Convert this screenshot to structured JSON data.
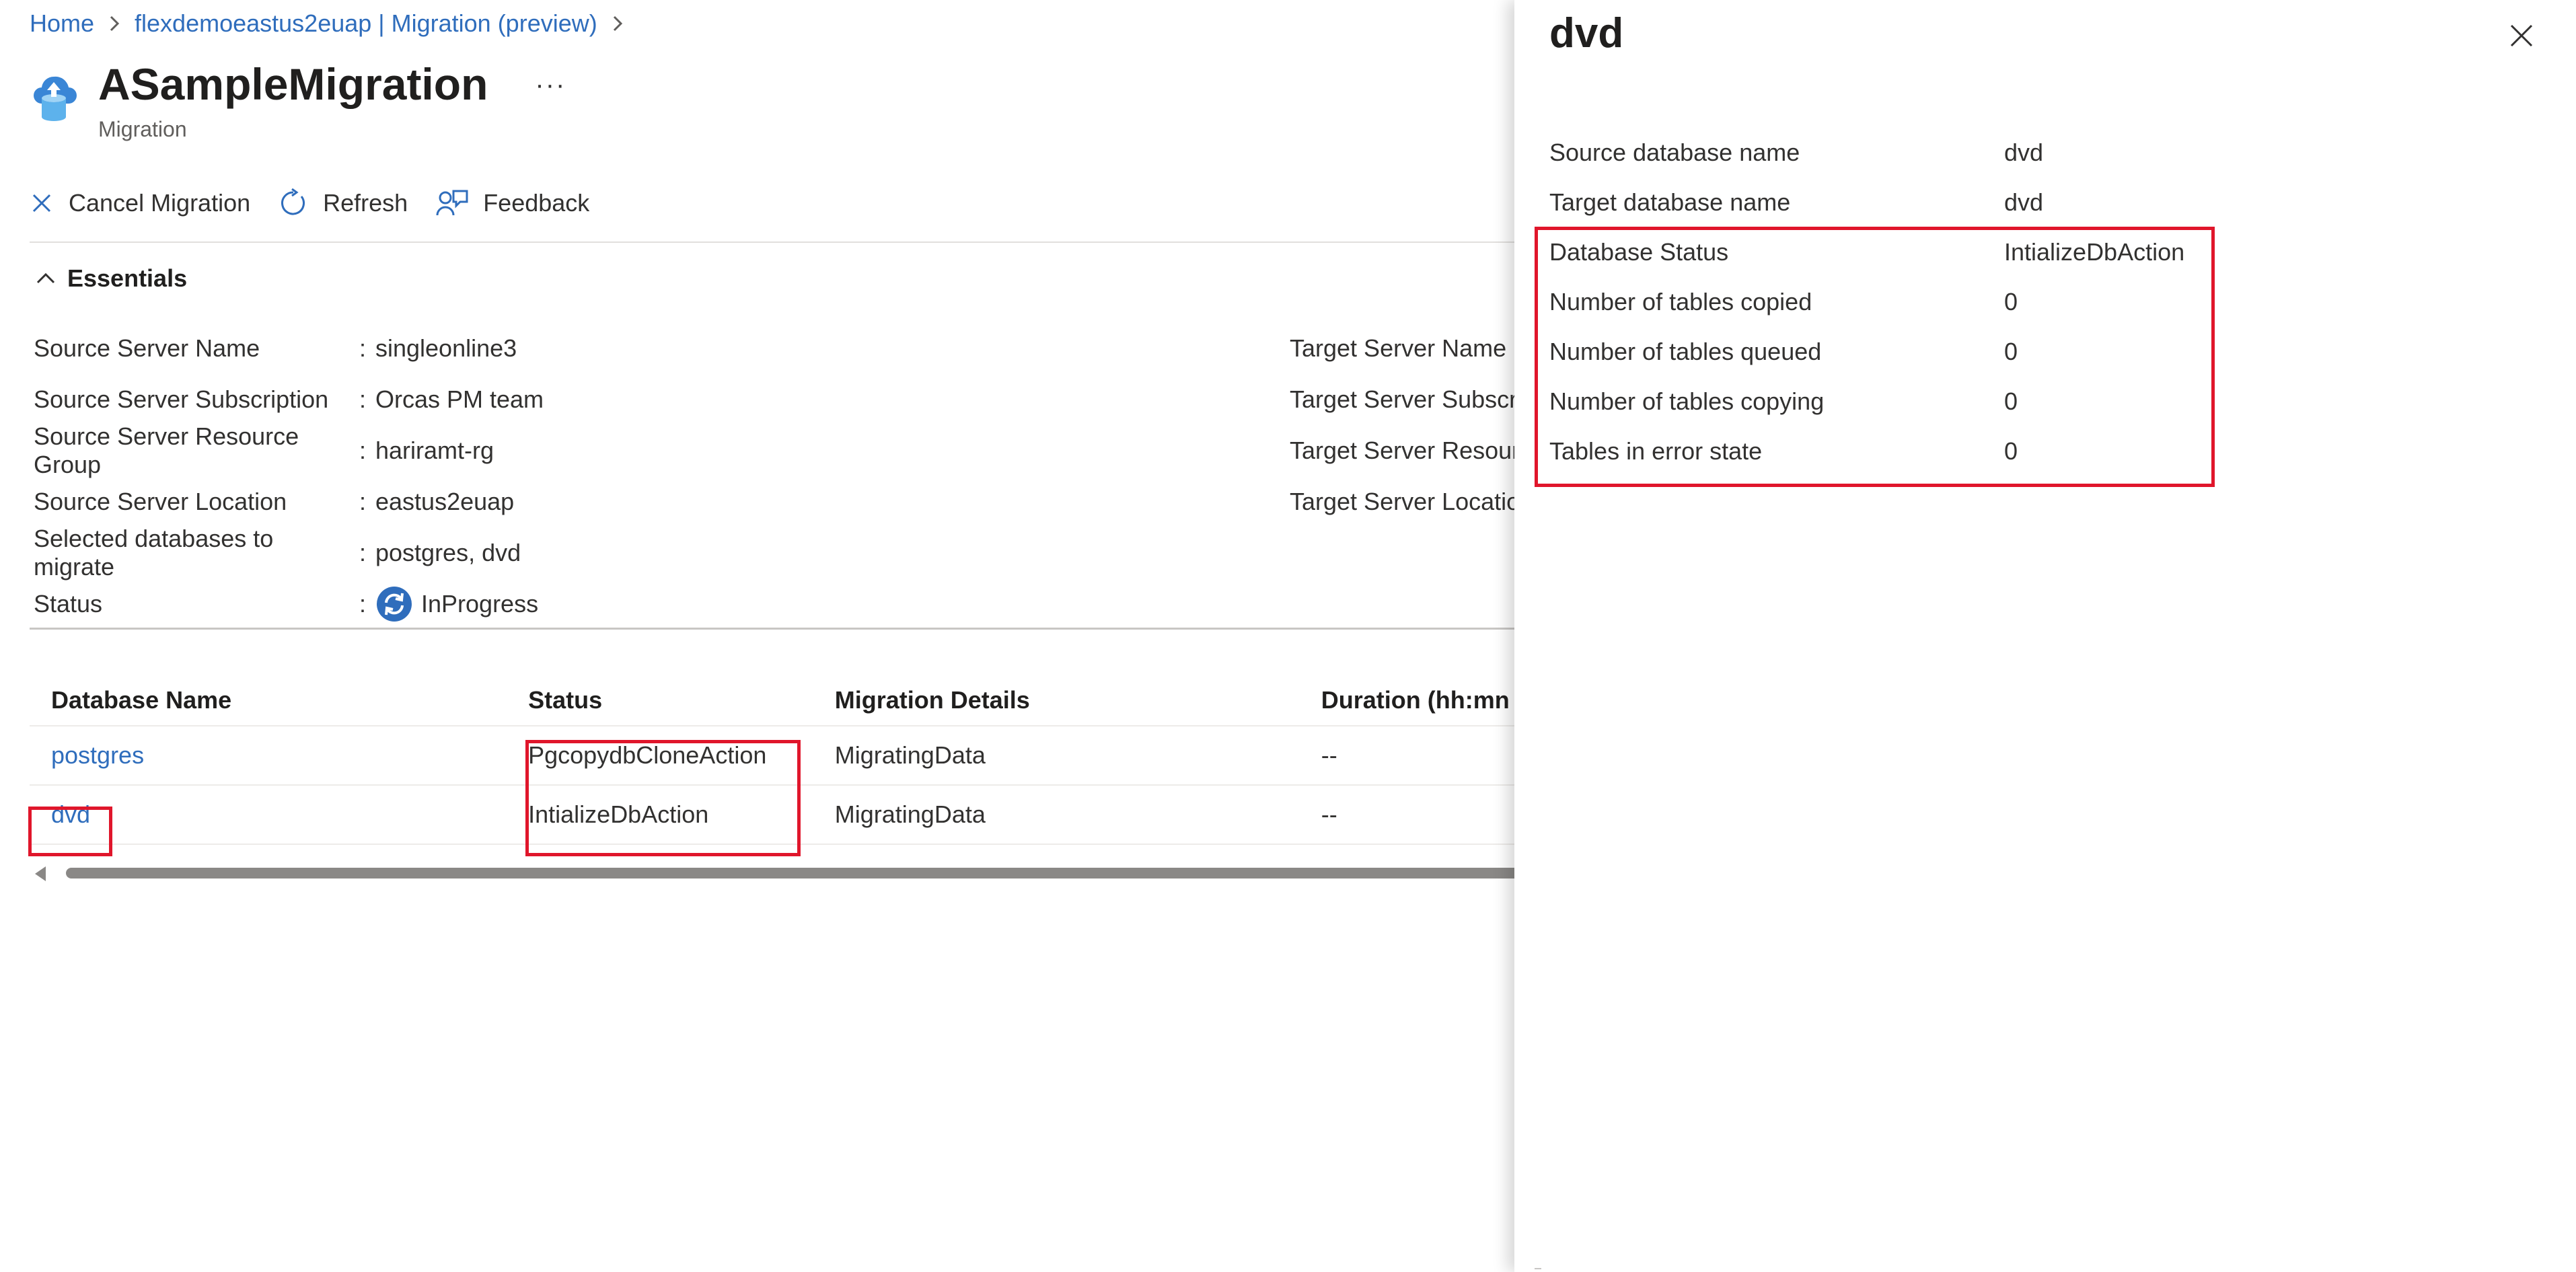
{
  "breadcrumb": {
    "home": "Home",
    "server": "flexdemoeastus2euap | Migration (preview)"
  },
  "header": {
    "title": "ASampleMigration",
    "subtitle": "Migration",
    "more": "···"
  },
  "toolbar": {
    "cancel": "Cancel Migration",
    "refresh": "Refresh",
    "feedback": "Feedback"
  },
  "essentials": {
    "toggle": "Essentials",
    "left": [
      {
        "label": "Source Server Name",
        "value": "singleonline3"
      },
      {
        "label": "Source Server Subscription",
        "value": "Orcas PM team"
      },
      {
        "label": "Source Server Resource Group",
        "value": "hariramt-rg"
      },
      {
        "label": "Source Server Location",
        "value": "eastus2euap"
      },
      {
        "label": "Selected databases to migrate",
        "value": "postgres, dvd"
      },
      {
        "label": "Status",
        "value": "InProgress"
      }
    ],
    "right": [
      {
        "label": "Target Server Name"
      },
      {
        "label": "Target Server Subscrip"
      },
      {
        "label": "Target Server Resourc"
      },
      {
        "label": "Target Server Locatior"
      }
    ]
  },
  "table": {
    "headers": [
      "Database Name",
      "Status",
      "Migration Details",
      "Duration (hh:mn"
    ],
    "rows": [
      {
        "name": "postgres",
        "status": "PgcopydbCloneAction",
        "details": "MigratingData",
        "duration": "--"
      },
      {
        "name": "dvd",
        "status": "IntializeDbAction",
        "details": "MigratingData",
        "duration": "--"
      }
    ]
  },
  "panel": {
    "title": "dvd",
    "rows": [
      {
        "label": "Source database name",
        "value": "dvd"
      },
      {
        "label": "Target database name",
        "value": "dvd"
      },
      {
        "label": "Database Status",
        "value": "IntializeDbAction"
      },
      {
        "label": "Number of tables copied",
        "value": "0"
      },
      {
        "label": "Number of tables queued",
        "value": "0"
      },
      {
        "label": "Number of tables copying",
        "value": "0"
      },
      {
        "label": "Tables in error state",
        "value": "0"
      }
    ]
  },
  "colors": {
    "link": "#2f6dbc",
    "highlight": "#e0162b",
    "status_icon": "#2f6dbc"
  }
}
